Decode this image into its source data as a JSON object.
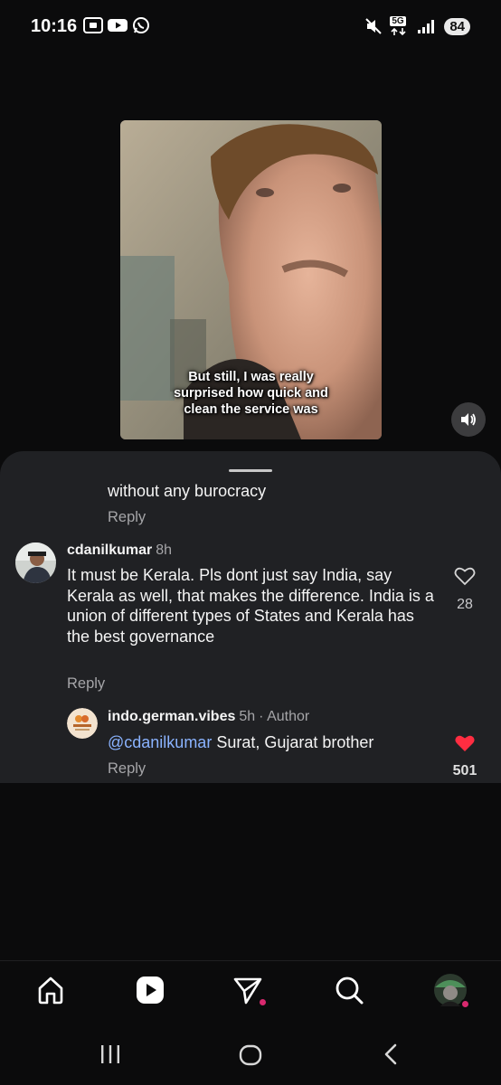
{
  "status_bar": {
    "time": "10:16",
    "network": "5G",
    "battery": "84"
  },
  "video": {
    "caption_lines": [
      "But still, I was really",
      "surprised how quick and",
      "clean the service was"
    ]
  },
  "comments": {
    "partial": {
      "text": "without any burocracy",
      "reply_label": "Reply"
    },
    "main": {
      "username": "cdanilkumar",
      "time": "8h",
      "text": "It must be Kerala. Pls dont just say India, say Kerala as well, that makes the difference. India is a union of different types of States and Kerala has the best governance",
      "reply_label": "Reply",
      "like_count": "28"
    },
    "reply": {
      "username": "indo.german.vibes",
      "time": "5h",
      "author_label": "· Author",
      "mention": "@cdanilkumar",
      "text": "Surat, Gujarat brother",
      "reply_label": "Reply",
      "like_count": "501"
    }
  },
  "bottom_nav": {
    "items": [
      "home-icon",
      "reels-icon",
      "send-icon",
      "search-icon",
      "profile-avatar"
    ]
  },
  "colors": {
    "sheet_bg": "#202124",
    "like_red": "#ff2d41",
    "mention_blue": "#8ab3ff",
    "notification_dot": "#d9296f"
  }
}
